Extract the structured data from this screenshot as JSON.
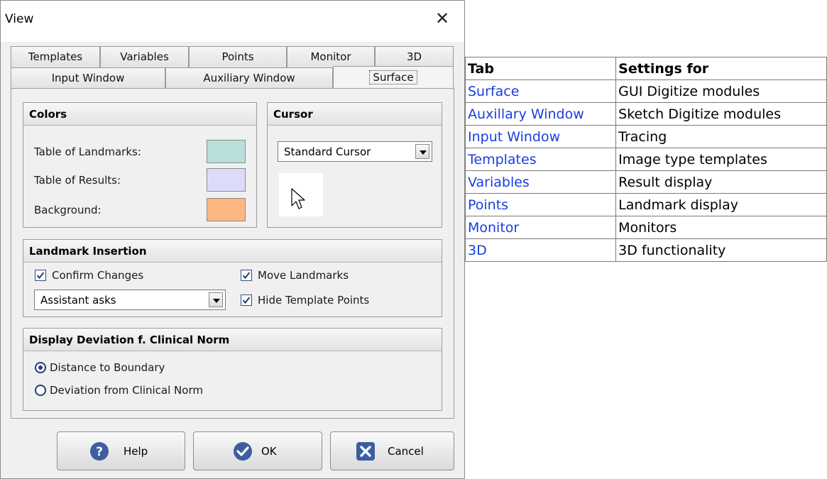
{
  "dialog": {
    "title": "View",
    "tabs_top": [
      "Templates",
      "Variables",
      "Points",
      "Monitor",
      "3D"
    ],
    "tabs_bottom": [
      "Input Window",
      "Auxiliary Window",
      "Surface"
    ],
    "active_tab": "Surface",
    "colors": {
      "header": "Colors",
      "items": [
        {
          "label": "Table of Landmarks:",
          "color": "#b9dfdb"
        },
        {
          "label": "Table of Results:",
          "color": "#dcdcfa"
        },
        {
          "label": "Background:",
          "color": "#fdb782"
        }
      ]
    },
    "cursor": {
      "header": "Cursor",
      "selected": "Standard Cursor",
      "preview_icon": "arrow-cursor-icon"
    },
    "landmark": {
      "header": "Landmark Insertion",
      "confirm_changes": {
        "label": "Confirm Changes",
        "checked": true
      },
      "move_landmarks": {
        "label": "Move Landmarks",
        "checked": true
      },
      "hide_template_points": {
        "label": "Hide Template Points",
        "checked": true
      },
      "assistant_select": "Assistant asks"
    },
    "deviation": {
      "header": "Display Deviation f. Clinical Norm",
      "options": [
        {
          "label": "Distance to Boundary",
          "selected": true
        },
        {
          "label": "Deviation from Clinical Norm",
          "selected": false
        }
      ]
    },
    "buttons": {
      "help": "Help",
      "ok": "OK",
      "cancel": "Cancel"
    }
  },
  "doc_table": {
    "headers": [
      "Tab",
      "Settings for"
    ],
    "rows": [
      [
        "Surface",
        "GUI Digitize modules"
      ],
      [
        "Auxillary Window",
        "Sketch Digitize modules"
      ],
      [
        "Input Window",
        "Tracing"
      ],
      [
        "Templates",
        "Image type templates"
      ],
      [
        "Variables",
        "Result display"
      ],
      [
        "Points",
        "Landmark display"
      ],
      [
        "Monitor",
        "Monitors"
      ],
      [
        "3D",
        "3D functionality"
      ]
    ],
    "link_color": "#1a3de0"
  }
}
